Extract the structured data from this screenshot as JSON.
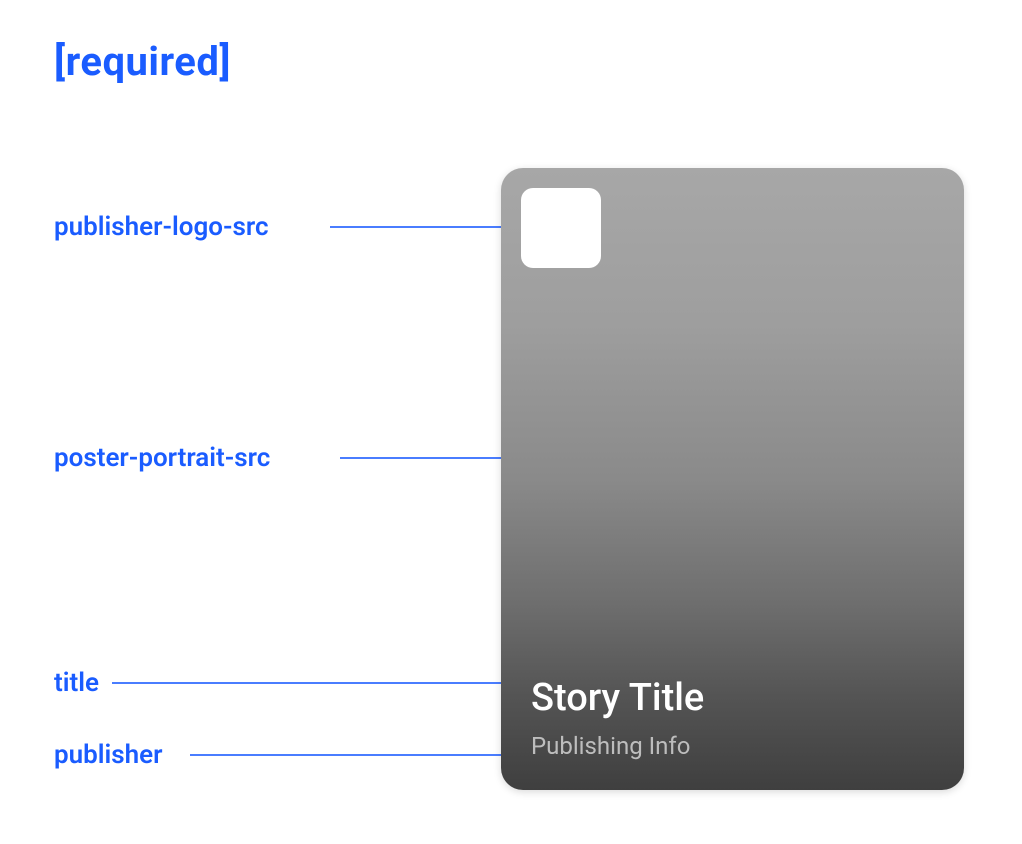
{
  "heading": "[required]",
  "labels": {
    "publisher_logo_src": "publisher-logo-src",
    "poster_portrait_src": "poster-portrait-src",
    "title": "title",
    "publisher": "publisher"
  },
  "card": {
    "title": "Story Title",
    "publisher": "Publishing Info"
  },
  "colors": {
    "accent": "#1a5cff"
  }
}
